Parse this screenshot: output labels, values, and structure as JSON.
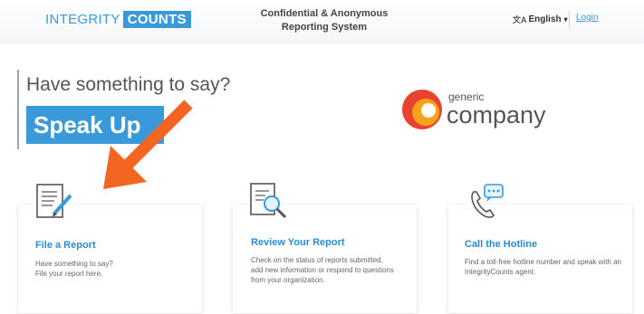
{
  "header": {
    "logo": {
      "part1": "INTEGRITY",
      "part2": "COUNTS"
    },
    "system_title_line1": "Confidential & Anonymous",
    "system_title_line2": "Reporting System",
    "language": "English",
    "login_label": "Login"
  },
  "hero": {
    "question": "Have something to say?",
    "speak_up": "Speak Up",
    "company_small": "generic",
    "company_big": "company"
  },
  "cards": [
    {
      "title": "File a Report",
      "text_line1": "Have something to say?",
      "text_line2": "File your report here.",
      "icon": "document-pen-icon"
    },
    {
      "title": "Review Your Report",
      "text": "Check on the status of reports submitted, add new information or respond to questions from your organization.",
      "icon": "document-search-icon"
    },
    {
      "title": "Call the Hotline",
      "text": "Find a toll-free hotline number and speak with an IntegrityCounts agent.",
      "icon": "phone-chat-icon"
    }
  ],
  "colors": {
    "brand_blue": "#3a9ad9",
    "arrow_orange": "#f26522",
    "company_red": "#e8432e",
    "company_orange": "#f7a21b"
  }
}
